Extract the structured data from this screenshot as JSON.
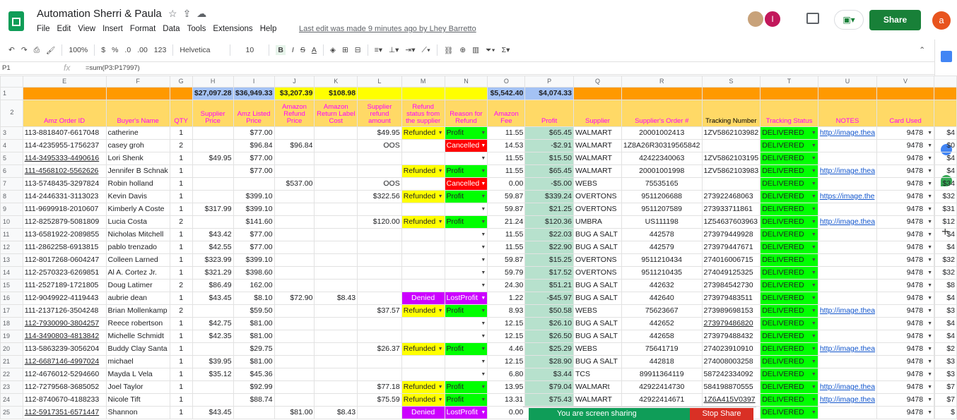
{
  "app": {
    "title": "Automation Sherri & Paula",
    "last_edit": "Last edit was made 9 minutes ago by Lhey Barretto",
    "share_label": "Share",
    "account_initial": "a",
    "avatar_initial": "I"
  },
  "menu": [
    "File",
    "Edit",
    "View",
    "Insert",
    "Format",
    "Data",
    "Tools",
    "Extensions",
    "Help"
  ],
  "toolbar": {
    "zoom": "100%",
    "currency": "$",
    "percent": "%",
    "dec_less": ".0",
    "dec_more": ".00",
    "format": "123",
    "font": "Helvetica",
    "size": "10",
    "bold": "B",
    "italic": "I",
    "strike": "S",
    "textcolor": "A"
  },
  "formula": {
    "cell": "P1",
    "fx": "fx",
    "text": "=sum(P3:P17997)"
  },
  "columns": [
    "E",
    "F",
    "G",
    "H",
    "I",
    "J",
    "K",
    "L",
    "M",
    "N",
    "O",
    "P",
    "Q",
    "R",
    "S",
    "T",
    "U",
    "V",
    ""
  ],
  "totals": {
    "H": "$27,097.28",
    "I": "$36,949.33",
    "J": "$3,207.39",
    "K": "$108.98",
    "O": "$5,542.40",
    "P": "$4,074.33"
  },
  "headers": {
    "E": "Amz Order ID",
    "F": "Buyer's Name",
    "G": "QTY",
    "H": "Supplier Price",
    "I": "Amz Listed Price",
    "J": "Amazon Refund Price",
    "K": "Amazon Return Label Cost",
    "L": "Supplier refund amount",
    "M": "Refund status from the supplier",
    "N": "Reason for Refund",
    "O": "Amazon Fee",
    "P": "Profit",
    "Q": "Supplier",
    "R": "Supplier's Order #",
    "S": "Tracking Number",
    "T": "Tracking Status",
    "U": "NOTES",
    "V": "Card Used"
  },
  "rows": [
    {
      "n": "3",
      "e": "113-8818407-6617048",
      "f": "catherine",
      "g": "1",
      "h": "",
      "i": "$77.00",
      "j": "",
      "k": "",
      "l": "$49.95",
      "m": "Refunded",
      "n2": "Profit",
      "o": "11.55",
      "p": "$65.45",
      "q": "WALMART",
      "r": "20001002413",
      "s": "1ZV5862103982",
      "t": "DELIVERED",
      "u": "http://image.thea",
      "v": "9478",
      "w": "$4"
    },
    {
      "n": "4",
      "e": "114-4235955-1756237",
      "f": "casey groh",
      "g": "2",
      "h": "",
      "i": "$96.84",
      "j": "$96.84",
      "k": "",
      "l": "OOS",
      "m": "",
      "n2": "Cancelled",
      "o": "14.53",
      "p": "-$2.91",
      "q": "WALMART",
      "r": "1Z8A26R30319565842",
      "s": "",
      "t": "DELIVERED",
      "u": "",
      "v": "9478",
      "w": "$0"
    },
    {
      "n": "5",
      "e": "114-3495333-4490616",
      "f": "Lori Shenk",
      "g": "1",
      "h": "$49.95",
      "i": "$77.00",
      "j": "",
      "k": "",
      "l": "",
      "m": "",
      "n2": "",
      "o": "11.55",
      "p": "$15.50",
      "q": "WALMART",
      "r": "42422340063",
      "s": "1ZV5862103195",
      "t": "DELIVERED",
      "u": "",
      "v": "9478",
      "w": "$4"
    },
    {
      "n": "6",
      "e": "111-4568102-5562626",
      "f": "Jennifer B Schnak",
      "g": "1",
      "h": "",
      "i": "$77.00",
      "j": "",
      "k": "",
      "l": "",
      "m": "Refunded",
      "n2": "Profit",
      "o": "11.55",
      "p": "$65.45",
      "q": "WALMART",
      "r": "20001001998",
      "s": "1ZV5862103983",
      "t": "DELIVERED",
      "u": "http://image.thea",
      "v": "9478",
      "w": "$4"
    },
    {
      "n": "7",
      "e": "113-5748435-3297824",
      "f": "Robin holland",
      "g": "1",
      "h": "",
      "i": "",
      "j": "$537.00",
      "k": "",
      "l": "OOS",
      "m": "",
      "n2": "Cancelled",
      "o": "0.00",
      "p": "-$5.00",
      "q": "WEBS",
      "r": "75535165",
      "s": "",
      "t": "DELIVERED",
      "u": "",
      "v": "9478",
      "w": "$34"
    },
    {
      "n": "8",
      "e": "114-2446331-3113023",
      "f": "Kevin Davis",
      "g": "1",
      "h": "",
      "i": "$399.10",
      "j": "",
      "k": "",
      "l": "$322.56",
      "m": "Refunded",
      "n2": "Profit",
      "o": "59.87",
      "p": "$339.24",
      "q": "OVERTONS",
      "r": "9511206688",
      "s": "273922468063",
      "t": "DELIVERED",
      "u": "https://image.the",
      "v": "9478",
      "w": "$32"
    },
    {
      "n": "9",
      "e": "111-9699918-2010607",
      "f": "Kimberly A Coste",
      "g": "1",
      "h": "$317.99",
      "i": "$399.10",
      "j": "",
      "k": "",
      "l": "",
      "m": "",
      "n2": "",
      "o": "59.87",
      "p": "$21.25",
      "q": "OVERTONS",
      "r": "9511207589",
      "s": "273933711861",
      "t": "DELIVERED",
      "u": "",
      "v": "9478",
      "w": "$31"
    },
    {
      "n": "10",
      "e": "112-8252879-5081809",
      "f": "Lucia Costa",
      "g": "2",
      "h": "",
      "i": "$141.60",
      "j": "",
      "k": "",
      "l": "$120.00",
      "m": "Refunded",
      "n2": "Profit",
      "o": "21.24",
      "p": "$120.36",
      "q": "UMBRA",
      "r": "US111198",
      "s": "1Z54637603963",
      "t": "DELIVERED",
      "u": "http://image.thea",
      "v": "9478",
      "w": "$12"
    },
    {
      "n": "11",
      "e": "113-6581922-2089855",
      "f": "Nicholas Mitchell",
      "g": "1",
      "h": "$43.42",
      "i": "$77.00",
      "j": "",
      "k": "",
      "l": "",
      "m": "",
      "n2": "",
      "o": "11.55",
      "p": "$22.03",
      "q": "BUG A SALT",
      "r": "442578",
      "s": "273979449928",
      "t": "DELIVERED",
      "u": "",
      "v": "9478",
      "w": "$4"
    },
    {
      "n": "12",
      "e": "111-2862258-6913815",
      "f": "pablo trenzado",
      "g": "1",
      "h": "$42.55",
      "i": "$77.00",
      "j": "",
      "k": "",
      "l": "",
      "m": "",
      "n2": "",
      "o": "11.55",
      "p": "$22.90",
      "q": "BUG A SALT",
      "r": "442579",
      "s": "273979447671",
      "t": "DELIVERED",
      "u": "",
      "v": "9478",
      "w": "$4"
    },
    {
      "n": "13",
      "e": "112-8017268-0604247",
      "f": "Colleen Larned",
      "g": "1",
      "h": "$323.99",
      "i": "$399.10",
      "j": "",
      "k": "",
      "l": "",
      "m": "",
      "n2": "",
      "o": "59.87",
      "p": "$15.25",
      "q": "OVERTONS",
      "r": "9511210434",
      "s": "274016006715",
      "t": "DELIVERED",
      "u": "",
      "v": "9478",
      "w": "$32"
    },
    {
      "n": "14",
      "e": "112-2570323-6269851",
      "f": "Al A. Cortez Jr.",
      "g": "1",
      "h": "$321.29",
      "i": "$398.60",
      "j": "",
      "k": "",
      "l": "",
      "m": "",
      "n2": "",
      "o": "59.79",
      "p": "$17.52",
      "q": "OVERTONS",
      "r": "9511210435",
      "s": "274049125325",
      "t": "DELIVERED",
      "u": "",
      "v": "9478",
      "w": "$32"
    },
    {
      "n": "15",
      "e": "111-2527189-1721805",
      "f": "Doug Latimer",
      "g": "2",
      "h": "$86.49",
      "i": "162.00",
      "j": "",
      "k": "",
      "l": "",
      "m": "",
      "n2": "",
      "o": "24.30",
      "p": "$51.21",
      "q": "BUG A SALT",
      "r": "442632",
      "s": "273984542730",
      "t": "DELIVERED",
      "u": "",
      "v": "9478",
      "w": "$8"
    },
    {
      "n": "16",
      "e": "112-9049922-4119443",
      "f": "aubrie dean",
      "g": "1",
      "h": "$43.45",
      "i": "$8.10",
      "j": "$72.90",
      "k": "$8.43",
      "l": "",
      "m": "Denied",
      "n2": "LostProfit",
      "o": "1.22",
      "p": "-$45.97",
      "q": "BUG A SALT",
      "r": "442640",
      "s": "273979483511",
      "t": "DELIVERED",
      "u": "",
      "v": "9478",
      "w": "$4"
    },
    {
      "n": "17",
      "e": "111-2137126-3504248",
      "f": "Brian Mollenkamp",
      "g": "2",
      "h": "",
      "i": "$59.50",
      "j": "",
      "k": "",
      "l": "$37.57",
      "m": "Refunded",
      "n2": "Profit",
      "o": "8.93",
      "p": "$50.58",
      "q": "WEBS",
      "r": "75623667",
      "s": "273989698153",
      "t": "DELIVERED",
      "u": "http://image.thea",
      "v": "9478",
      "w": "$3"
    },
    {
      "n": "18",
      "e": "112-7930090-3804257",
      "f": "Reece robertson",
      "g": "1",
      "h": "$42.75",
      "i": "$81.00",
      "j": "",
      "k": "",
      "l": "",
      "m": "",
      "n2": "",
      "o": "12.15",
      "p": "$26.10",
      "q": "BUG A SALT",
      "r": "442652",
      "s": "273979486820",
      "t": "DELIVERED",
      "u": "",
      "v": "9478",
      "w": "$4"
    },
    {
      "n": "19",
      "e": "114-3490803-4813842",
      "f": "Michelle Schmidt",
      "g": "1",
      "h": "$42.35",
      "i": "$81.00",
      "j": "",
      "k": "",
      "l": "",
      "m": "",
      "n2": "",
      "o": "12.15",
      "p": "$26.50",
      "q": "BUG A SALT",
      "r": "442658",
      "s": "273979488432",
      "t": "DELIVERED",
      "u": "",
      "v": "9478",
      "w": "$4"
    },
    {
      "n": "20",
      "e": "113-5863239-3056204",
      "f": "Buddy Clay Santa",
      "g": "1",
      "h": "",
      "i": "$29.75",
      "j": "",
      "k": "",
      "l": "$26.37",
      "m": "Refunded",
      "n2": "Profit",
      "o": "4.46",
      "p": "$25.29",
      "q": "WEBS",
      "r": "75641719",
      "s": "274023910910",
      "t": "DELIVERED",
      "u": "http://image.thea",
      "v": "9478",
      "w": "$2"
    },
    {
      "n": "21",
      "e": "112-6687146-4997024",
      "f": "michael",
      "g": "1",
      "h": "$39.95",
      "i": "$81.00",
      "j": "",
      "k": "",
      "l": "",
      "m": "",
      "n2": "",
      "o": "12.15",
      "p": "$28.90",
      "q": "BUG A SALT",
      "r": "442818",
      "s": "274008003258",
      "t": "DELIVERED",
      "u": "",
      "v": "9478",
      "w": "$3"
    },
    {
      "n": "22",
      "e": "112-4676012-5294660",
      "f": "Mayda L Vela",
      "g": "1",
      "h": "$35.12",
      "i": "$45.36",
      "j": "",
      "k": "",
      "l": "",
      "m": "",
      "n2": "",
      "o": "6.80",
      "p": "$3.44",
      "q": "TCS",
      "r": "89911364119",
      "s": "587242334092",
      "t": "DELIVERED",
      "u": "",
      "v": "9478",
      "w": "$3"
    },
    {
      "n": "23",
      "e": "112-7279568-3685052",
      "f": "Joel Taylor",
      "g": "1",
      "h": "",
      "i": "$92.99",
      "j": "",
      "k": "",
      "l": "$77.18",
      "m": "Refunded",
      "n2": "Profit",
      "o": "13.95",
      "p": "$79.04",
      "q": "WALMARt",
      "r": "42922414730",
      "s": "584198870555",
      "t": "DELIVERED",
      "u": "http://image.thea",
      "v": "9478",
      "w": "$7"
    },
    {
      "n": "24",
      "e": "112-8740670-4188233",
      "f": "Nicole Tift",
      "g": "1",
      "h": "",
      "i": "$88.74",
      "j": "",
      "k": "",
      "l": "$75.59",
      "m": "Refunded",
      "n2": "Profit",
      "o": "13.31",
      "p": "$75.43",
      "q": "WALMART",
      "r": "42922414671",
      "s": "1Z6A415V0397",
      "t": "DELIVERED",
      "u": "http://image.thea",
      "v": "9478",
      "w": "$7"
    },
    {
      "n": "25",
      "e": "112-5917351-6571447",
      "f": "Shannon",
      "g": "1",
      "h": "$43.45",
      "i": "",
      "j": "$81.00",
      "k": "$8.43",
      "l": "",
      "m": "Denied",
      "n2": "LostProfit",
      "o": "0.00",
      "p": "",
      "q": "",
      "r": "",
      "s": "",
      "t": "DELIVERED",
      "u": "",
      "v": "9478",
      "w": "$"
    }
  ],
  "banner": {
    "text": "You are screen sharing",
    "stop": "Stop Share"
  }
}
